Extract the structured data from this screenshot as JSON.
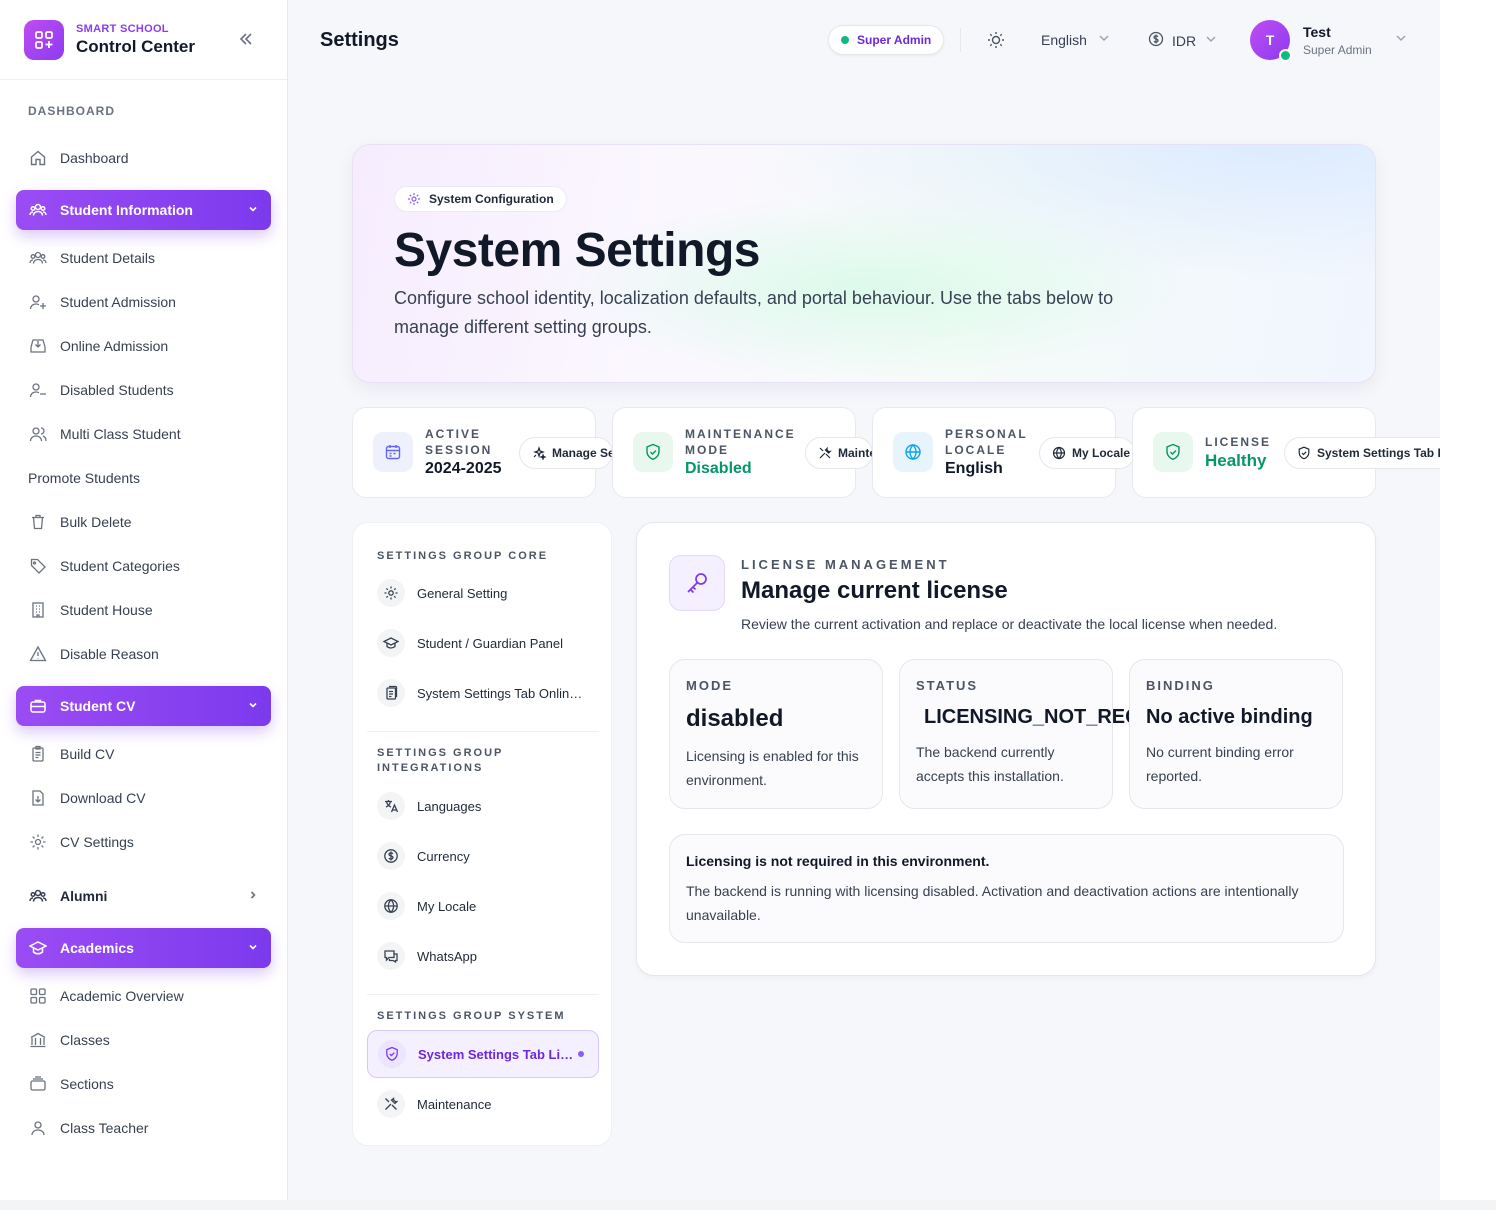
{
  "brand": {
    "sub": "SMART SCHOOL",
    "title": "Control Center"
  },
  "sidebar": {
    "heading": "DASHBOARD",
    "dashboard": "Dashboard",
    "student_info": {
      "label": "Student Information",
      "items": [
        "Student Details",
        "Student Admission",
        "Online Admission",
        "Disabled Students",
        "Multi Class Student",
        "Promote Students",
        "Bulk Delete",
        "Student Categories",
        "Student House",
        "Disable Reason"
      ]
    },
    "student_cv": {
      "label": "Student CV",
      "items": [
        "Build CV",
        "Download CV",
        "CV Settings"
      ]
    },
    "alumni": "Alumni",
    "academics": {
      "label": "Academics",
      "items": [
        "Academic Overview",
        "Classes",
        "Sections",
        "Class Teacher"
      ]
    }
  },
  "topbar": {
    "title": "Settings",
    "role": "Super Admin",
    "language": "English",
    "currency": "IDR",
    "user_initial": "T",
    "user_name": "Test",
    "user_role": "Super Admin"
  },
  "hero": {
    "pill": "System Configuration",
    "title": "System Settings",
    "desc": "Configure school identity, localization defaults, and portal behaviour. Use the tabs below to manage different setting groups."
  },
  "stats": [
    {
      "label": "ACTIVE SESSION",
      "value": "2024-2025",
      "button": "Manage Sessions"
    },
    {
      "label": "MAINTENANCE MODE",
      "value": "Disabled",
      "button": "Maintenance"
    },
    {
      "label": "PERSONAL LOCALE",
      "value": "English",
      "button": "My Locale"
    },
    {
      "label": "LICENSE",
      "value": "Healthy",
      "button": "System Settings Tab License"
    }
  ],
  "menu": {
    "core_heading": "SETTINGS GROUP CORE",
    "core": [
      "General Setting",
      "Student / Guardian Panel",
      "System Settings Tab Online Admission"
    ],
    "integrations_heading": "SETTINGS GROUP INTEGRATIONS",
    "integrations": [
      "Languages",
      "Currency",
      "My Locale",
      "WhatsApp"
    ],
    "system_heading": "SETTINGS GROUP SYSTEM",
    "system": [
      "System Settings Tab License",
      "Maintenance"
    ]
  },
  "license": {
    "eyebrow": "LICENSE MANAGEMENT",
    "title": "Manage current license",
    "desc": "Review the current activation and replace or deactivate the local license when needed.",
    "cards": [
      {
        "label": "MODE",
        "value": "disabled",
        "text": "Licensing is enabled for this environment."
      },
      {
        "label": "STATUS",
        "value": "LICENSING_NOT_REQUIRED",
        "text": "The backend currently accepts this installation."
      },
      {
        "label": "BINDING",
        "value": "No active binding",
        "text": "No current binding error reported."
      }
    ],
    "notice_title": "Licensing is not required in this environment.",
    "notice_text": "The backend is running with licensing disabled. Activation and deactivation actions are intentionally unavailable."
  },
  "colors": {
    "accent": "#7c3aed",
    "success": "#059669",
    "online": "#10b981"
  }
}
